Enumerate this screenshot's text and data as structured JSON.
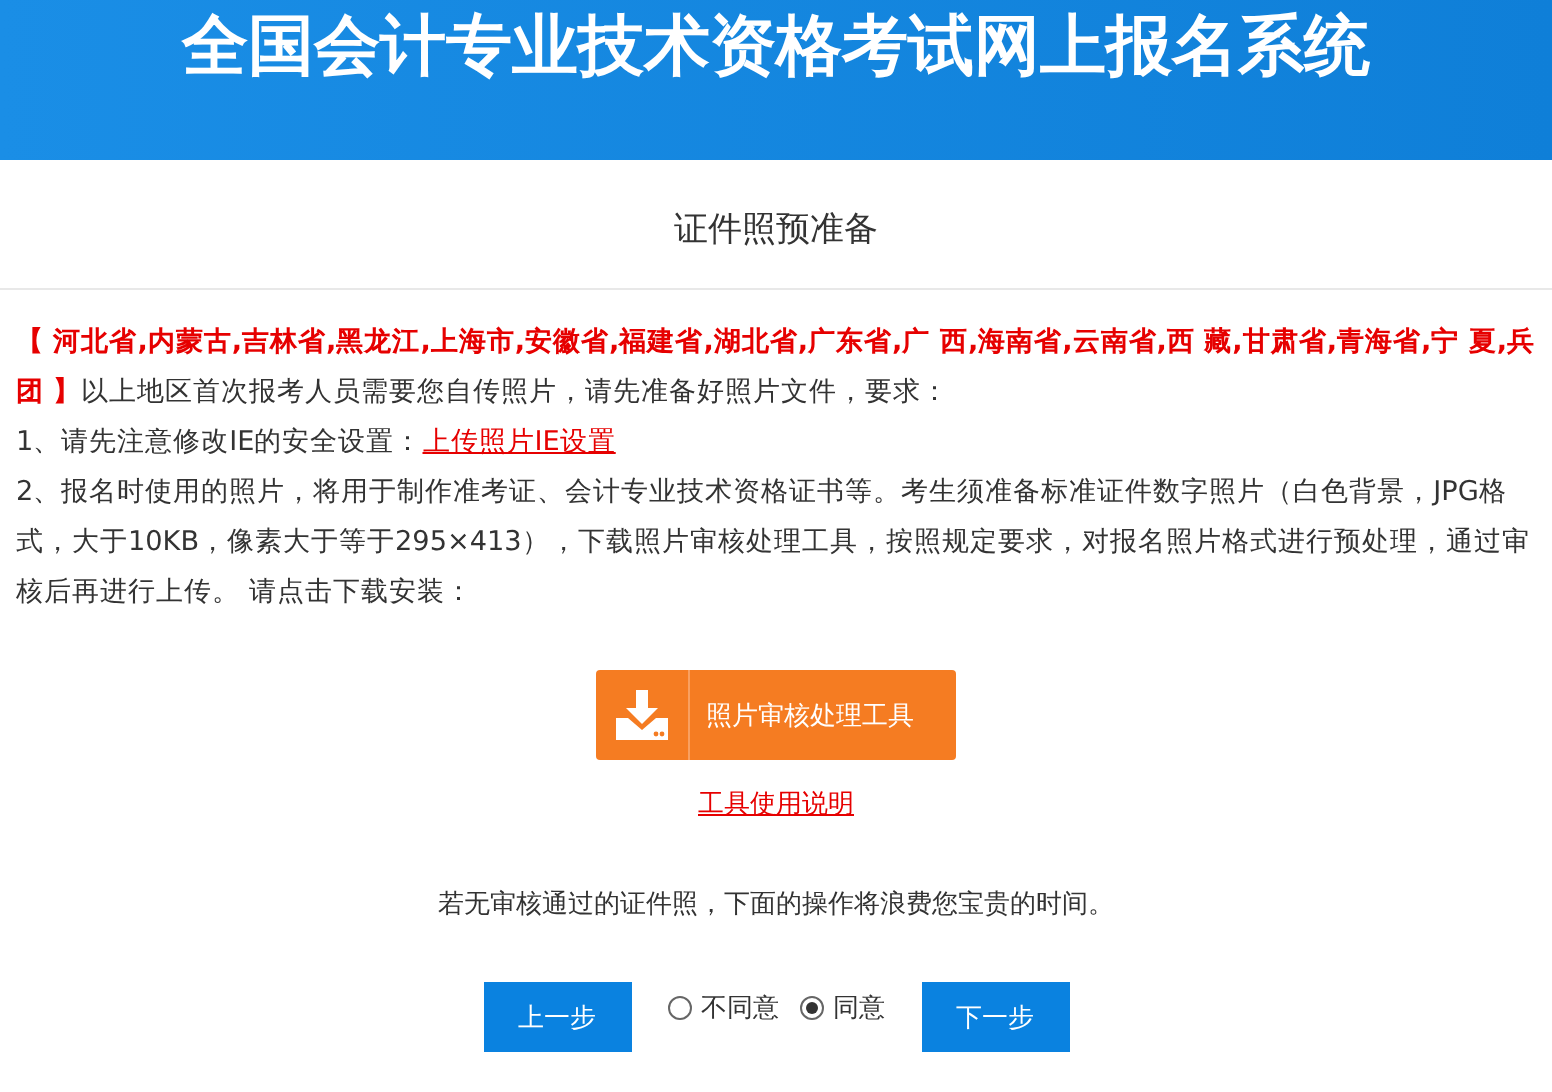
{
  "header": {
    "title": "全国会计专业技术资格考试网上报名系统"
  },
  "section_title": "证件照预准备",
  "notice": "**【 河北省,内蒙古,吉林省,黑龙江,上海市,安徽省,福建省,湖北省,广东省,广 西,海南省,云南省,西 藏,甘肃省,青海省,宁 夏,兵团 】**以上地区首次报考人员需要您自传照片，请先准备好照片文件，要求：",
  "step1": {
    "text": "1、请先注意修改IE的安全设置：",
    "link": "上传照片IE设置"
  },
  "step2": "2、报名时使用的照片，将用于制作准考证、会计专业技术资格证书等。考生须准备标准证件数字照片（白色背景，JPG格式，大于10KB，像素大于等于295×413），下载照片审核处理工具，按照规定要求，对报名照片格式进行预处理，通过审核后再进行上传。 请点击下载安装：",
  "download_button": "照片审核处理工具",
  "help_link": "工具使用说明",
  "warning": "若无审核通过的证件照，下面的操作将浪费您宝贵的时间。",
  "prev_button": "上一步",
  "options": [
    {
      "label": "不同意",
      "selected": false
    },
    {
      "label": "同意",
      "selected": true
    }
  ],
  "next_button": "下一步"
}
